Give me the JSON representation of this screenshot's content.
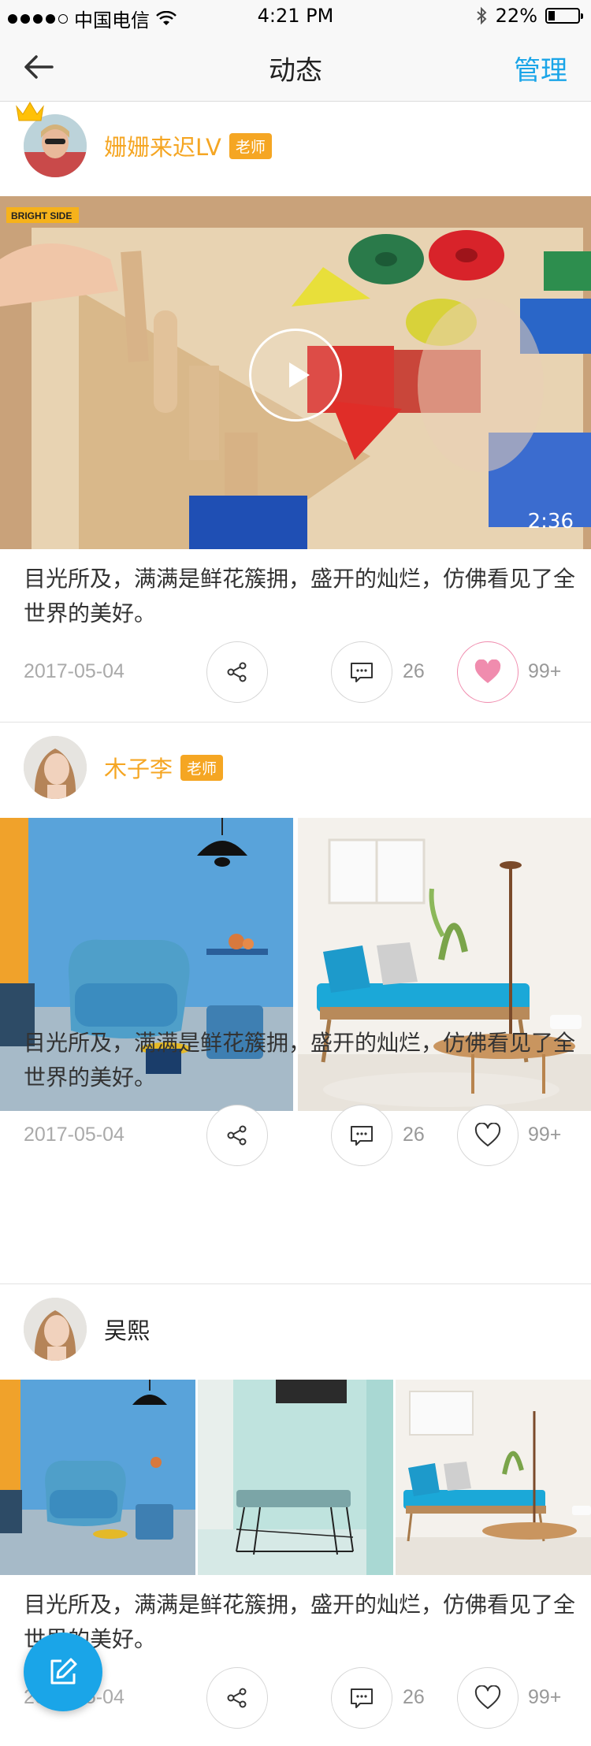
{
  "status_bar": {
    "carrier": "中国电信",
    "time": "4:21 PM",
    "battery": "22%",
    "battery_level": 0.22
  },
  "nav": {
    "title": "动态",
    "manage": "管理"
  },
  "posts": [
    {
      "user": "姗姗来迟LV",
      "role": "老师",
      "crown": true,
      "media": "video",
      "duration": "2:36",
      "video_tag": "BRIGHT SIDE",
      "text": "目光所及，满满是鲜花簇拥，盛开的灿烂，仿佛看见了全世界的美好。",
      "date": "2017-05-04",
      "comments": "26",
      "likes": "99+",
      "liked": true
    },
    {
      "user": "木子李",
      "role": "老师",
      "media": "two-images",
      "text": "目光所及，满满是鲜花簇拥，盛开的灿烂，仿佛看见了全世界的美好。",
      "date": "2017-05-04",
      "comments": "26",
      "likes": "99+",
      "liked": false
    },
    {
      "user": "吴熙",
      "media": "three-images",
      "text": "目光所及，满满是鲜花簇拥，盛开的灿烂，仿佛看见了全世界的美好。",
      "date": "2017-05-04",
      "comments": "26",
      "likes": "99+",
      "liked": false
    }
  ],
  "colors": {
    "accent": "#1aa5e8",
    "username": "#f5a623",
    "badge": "#f5a623",
    "like": "#f08cae"
  },
  "icons": [
    "back-arrow-icon",
    "share-icon",
    "comment-icon",
    "heart-icon",
    "edit-icon",
    "play-icon",
    "crown-icon",
    "wifi-icon",
    "bluetooth-icon",
    "battery-icon"
  ]
}
